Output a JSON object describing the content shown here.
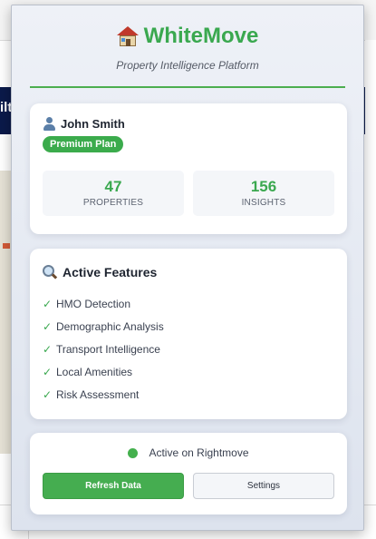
{
  "background": {
    "nav_text": "ilt"
  },
  "header": {
    "brand": "WhiteMove",
    "brand_color": "#3aa84f",
    "subtitle": "Property Intelligence Platform"
  },
  "user": {
    "name": "John Smith",
    "plan": "Premium Plan",
    "stats": [
      {
        "value": "47",
        "label": "PROPERTIES"
      },
      {
        "value": "156",
        "label": "INSIGHTS"
      }
    ]
  },
  "features": {
    "title": "Active Features",
    "items": [
      {
        "label": "HMO Detection"
      },
      {
        "label": "Demographic Analysis"
      },
      {
        "label": "Transport Intelligence"
      },
      {
        "label": "Local Amenities"
      },
      {
        "label": "Risk Assessment"
      }
    ]
  },
  "status": {
    "text": "Active on Rightmove",
    "dot_color": "#44b04d"
  },
  "actions": {
    "refresh_label": "Refresh Data",
    "settings_label": "Settings"
  }
}
